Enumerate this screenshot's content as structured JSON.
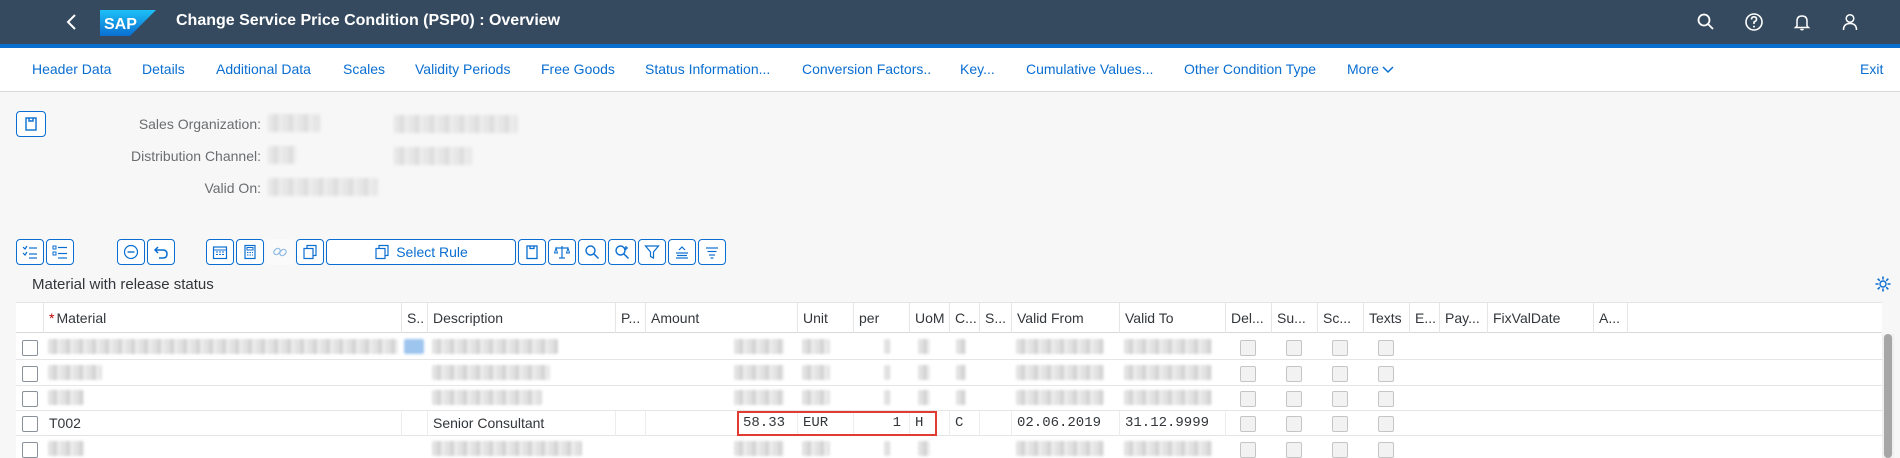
{
  "shell": {
    "logo_text": "SAP",
    "title": "Change Service Price Condition (PSP0) : Overview"
  },
  "menu": {
    "items": [
      "Header Data",
      "Details",
      "Additional Data",
      "Scales",
      "Validity Periods",
      "Free Goods",
      "Status Information...",
      "Conversion Factors..",
      "Key...",
      "Cumulative Values...",
      "Other Condition Type",
      "More",
      "Exit"
    ]
  },
  "header": {
    "sales_org_label": "Sales Organization:",
    "dist_channel_label": "Distribution Channel:",
    "valid_on_label": "Valid On:"
  },
  "toolbar": {
    "select_rule": "Select Rule"
  },
  "section_title": "Material with release status",
  "table": {
    "columns": [
      "Material",
      "S..",
      "Description",
      "P...",
      "Amount",
      "Unit",
      "per",
      "UoM",
      "C...",
      "S...",
      "Valid From",
      "Valid To",
      "Del...",
      "Su...",
      "Sc...",
      "Texts",
      "E...",
      "Pay...",
      "FixValDate",
      "A..."
    ],
    "row": {
      "material": "T002",
      "description": "Senior Consultant",
      "amount": "58.33",
      "unit": "EUR",
      "per": "1",
      "uom": "H",
      "c": "C",
      "valid_from": "02.06.2019",
      "valid_to": "31.12.9999"
    }
  },
  "colors": {
    "shell": "#354a5f",
    "accent": "#0a6ed1",
    "highlight": "#e03c31"
  }
}
